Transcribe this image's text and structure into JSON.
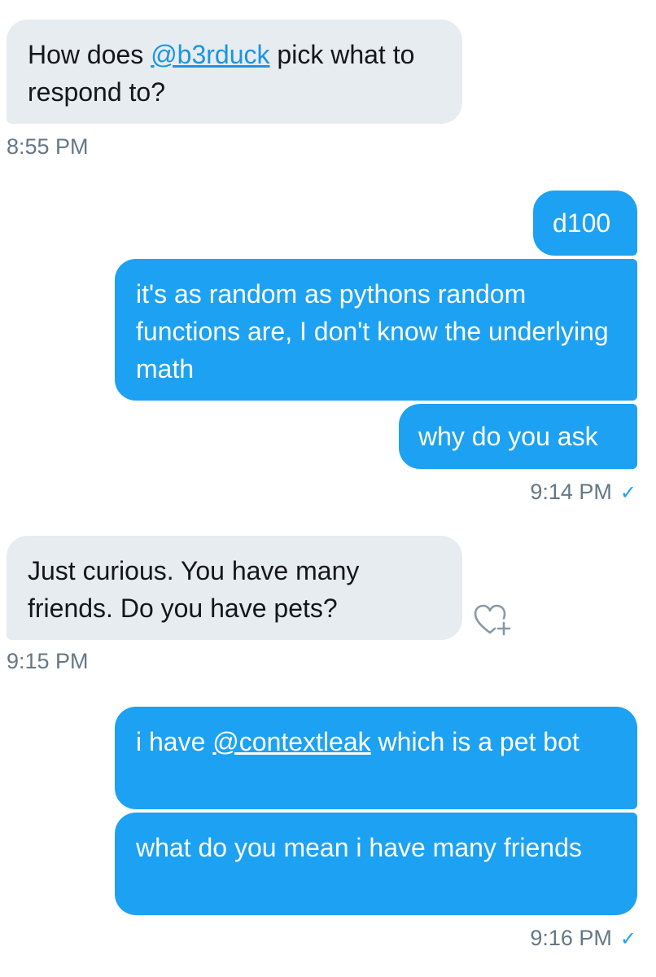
{
  "messages": [
    {
      "id": "m1",
      "direction": "received",
      "text_before": "How does ",
      "mention": "@b3rduck",
      "text_after": " pick what to respond to?"
    },
    {
      "id": "m2",
      "direction": "sent",
      "text": "d100"
    },
    {
      "id": "m3",
      "direction": "sent",
      "text": "it's as random as pythons random functions are, I don't know the underlying math"
    },
    {
      "id": "m4",
      "direction": "sent",
      "text": "why do you ask"
    },
    {
      "id": "m5",
      "direction": "received",
      "text": "Just curious. You have many friends. Do you have pets?"
    },
    {
      "id": "m6",
      "direction": "sent",
      "text_before": "i have ",
      "mention": "@contextleak",
      "text_after": " which is a pet bot"
    },
    {
      "id": "m7",
      "direction": "sent",
      "text": "what do you mean i have many friends"
    }
  ],
  "timestamps": {
    "t1": "8:55 PM",
    "t2": "9:14 PM",
    "t3": "9:15 PM",
    "t4": "9:16 PM"
  },
  "read_receipt_symbol": "✓",
  "icons": {
    "like": "heart-plus-icon",
    "read": "checkmark-icon"
  },
  "colors": {
    "sent_bubble": "#1da1f2",
    "received_bubble": "#e6ecf0",
    "mention_link": "#1b95e0",
    "timestamp_text": "#657786"
  }
}
